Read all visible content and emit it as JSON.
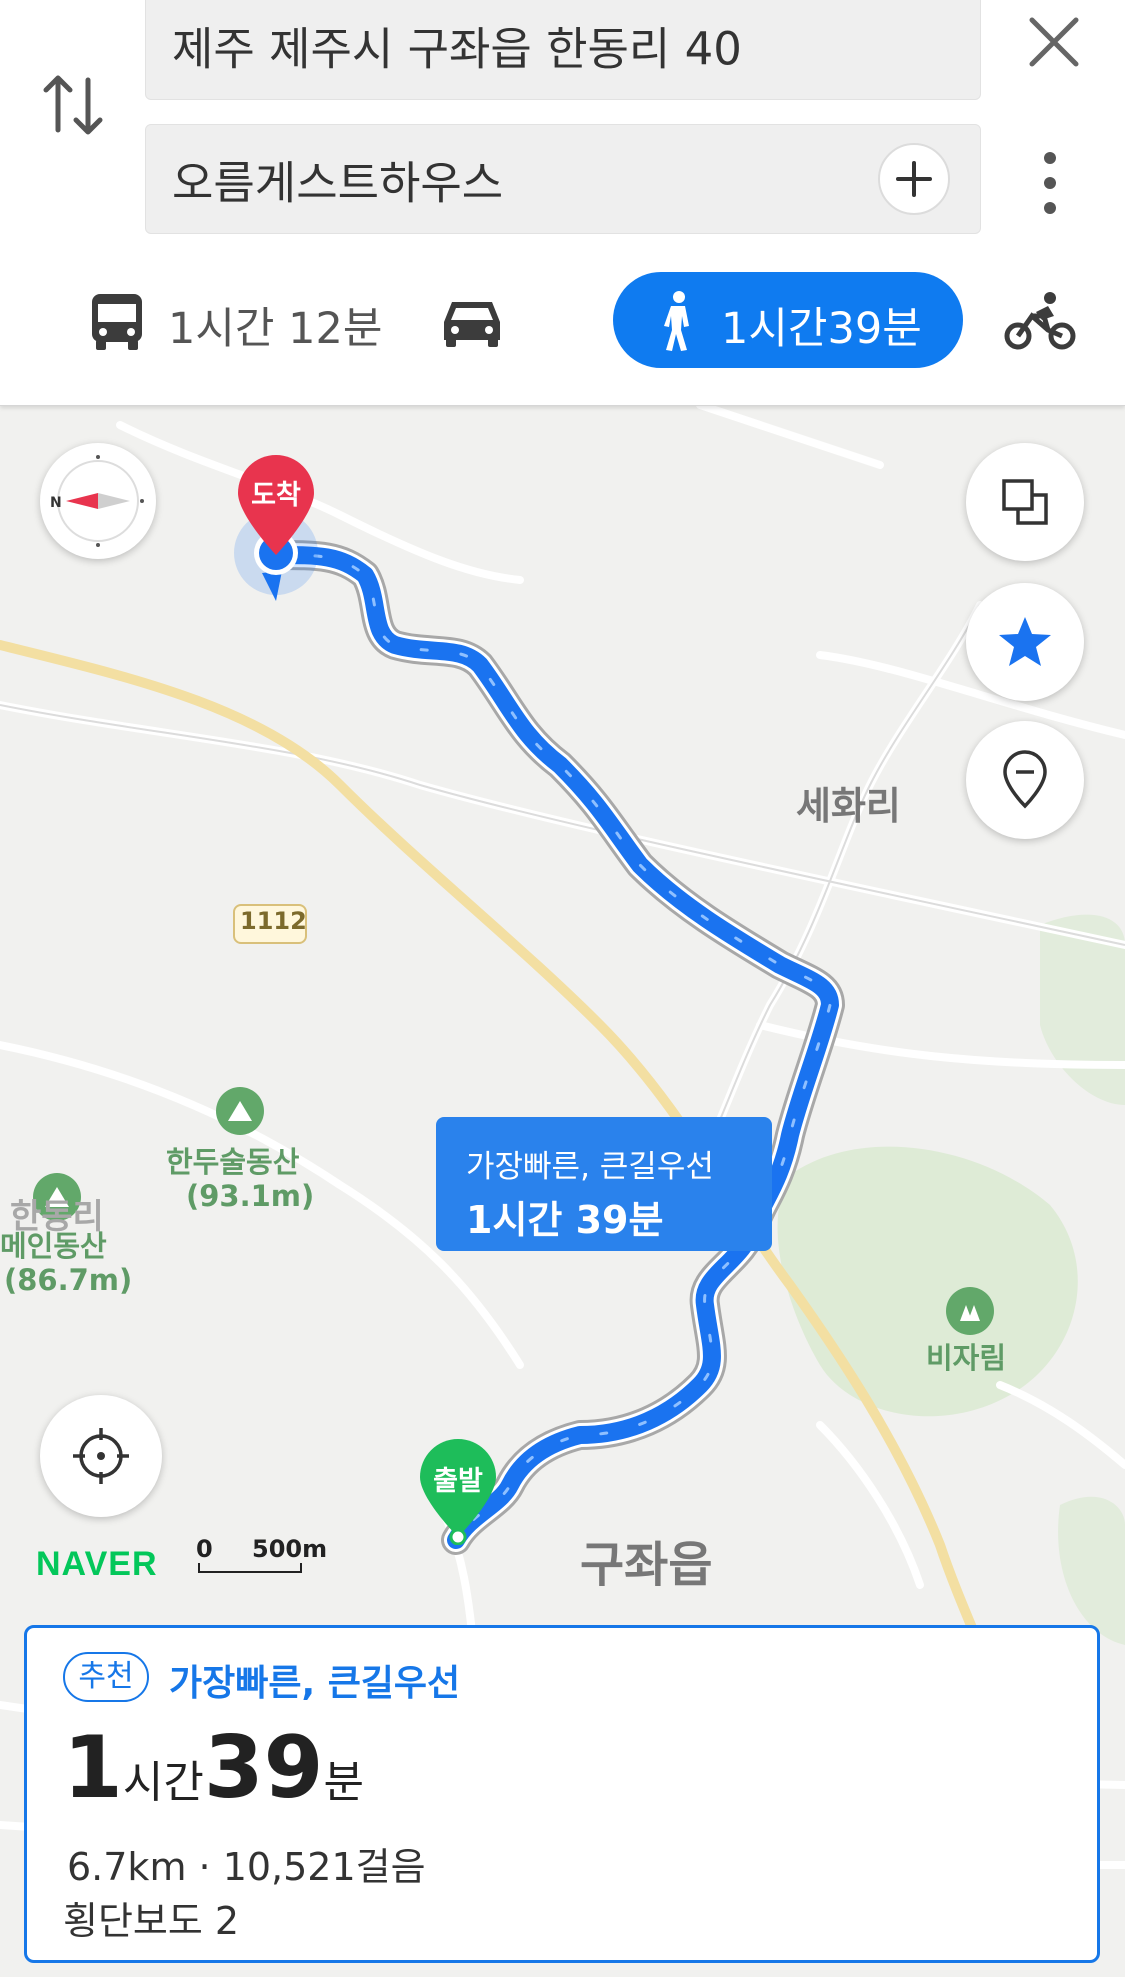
{
  "search": {
    "origin": "제주 제주시 구좌읍 한동리 40",
    "destination": "오름게스트하우스"
  },
  "icons": {
    "swap": "swap-vertical-icon",
    "close": "close-icon",
    "add": "plus-icon",
    "more": "more-vertical-icon",
    "bus": "bus-icon",
    "car": "car-icon",
    "walk": "walk-icon",
    "bike": "bicycle-icon"
  },
  "modes": {
    "bus_time": "1시간 12분",
    "car_time": "",
    "walk_time": "1시간39분",
    "selected": "walk"
  },
  "map": {
    "labels": {
      "sehwari": "세화리",
      "road_number": "1112",
      "handusul": "한두술동산",
      "handusul_height": "(93.1m)",
      "mein": "메인동산",
      "mein_height": "(86.7m)",
      "hadongri_partial": "한동리",
      "bijarim": "비자림",
      "gujwaeup": "구좌읍"
    },
    "pins": {
      "arrival": "도착",
      "departure": "출발"
    },
    "route_bubble": {
      "line1": "가장빠른, 큰길우선",
      "line2": "1시간 39분"
    },
    "brand": "NAVER",
    "scale": {
      "zero": "0",
      "distance": "500m"
    }
  },
  "colors": {
    "accent": "#0f7bf0",
    "route": "#1a73f0",
    "arrival_pin": "#e8344e",
    "departure_pin": "#1ebd5a",
    "naver": "#03c75a"
  },
  "summary": {
    "badge": "추천",
    "route_title": "가장빠른, 큰길우선",
    "hours": "1",
    "hours_unit": "시간",
    "minutes": "39",
    "minutes_unit": "분",
    "distance_steps": "6.7km · 10,521걸음",
    "crosswalks": "횡단보도 2"
  }
}
